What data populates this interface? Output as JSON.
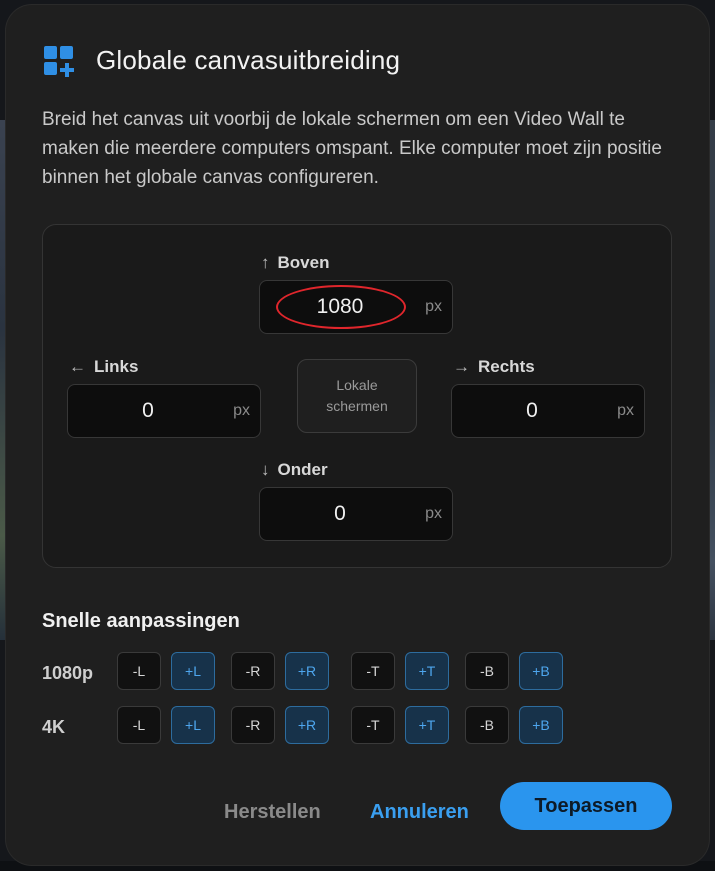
{
  "dialog": {
    "title": "Globale canvasuitbreiding",
    "description": "Breid het canvas uit voorbij de lokale schermen om een Video Wall te maken die meerdere computers omspant. Elke computer moet zijn positie binnen het globale canvas configureren."
  },
  "fields": {
    "top": {
      "label": "Boven",
      "value": "1080",
      "unit": "px",
      "arrow": "↑"
    },
    "left": {
      "label": "Links",
      "value": "0",
      "unit": "px",
      "arrow": "←"
    },
    "right": {
      "label": "Rechts",
      "value": "0",
      "unit": "px",
      "arrow": "→"
    },
    "bottom": {
      "label": "Onder",
      "value": "0",
      "unit": "px",
      "arrow": "↓"
    }
  },
  "center": {
    "line1": "Lokale",
    "line2": "schermen"
  },
  "quick": {
    "title": "Snelle aanpassingen",
    "rows": [
      {
        "label": "1080p",
        "chips": [
          "-L",
          "+L",
          "-R",
          "+R",
          "-T",
          "+T",
          "-B",
          "+B"
        ]
      },
      {
        "label": "4K",
        "chips": [
          "-L",
          "+L",
          "-R",
          "+R",
          "-T",
          "+T",
          "-B",
          "+B"
        ]
      }
    ]
  },
  "buttons": {
    "reset": "Herstellen",
    "cancel": "Annuleren",
    "apply": "Toepassen"
  },
  "colors": {
    "accent": "#2a95ee",
    "highlight": "#e0262c"
  },
  "icons": {
    "header": "grid-add-icon"
  }
}
